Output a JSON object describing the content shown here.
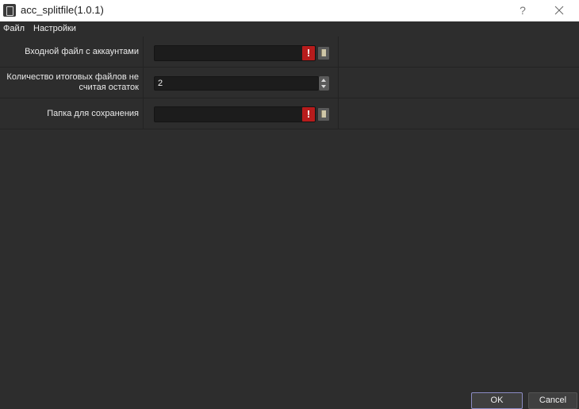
{
  "window": {
    "title": "acc_splitfile(1.0.1)",
    "help": "?",
    "close_icon": "close-icon",
    "app_icon": "app-icon"
  },
  "menu": {
    "items": [
      "Файл",
      "Настройки"
    ]
  },
  "form": {
    "rows": [
      {
        "label": "Входной файл с аккаунтами",
        "value": "",
        "warning": "!"
      },
      {
        "label": "Количество итоговых файлов не считая остаток",
        "value": "2"
      },
      {
        "label": "Папка для сохранения",
        "value": "",
        "warning": "!"
      }
    ]
  },
  "buttons": {
    "ok": "OK",
    "cancel": "Cancel"
  },
  "colors": {
    "background": "#2d2d2d",
    "field": "#1c1c1c",
    "warning": "#b71c1c",
    "ok_border": "#8c8cc4"
  }
}
